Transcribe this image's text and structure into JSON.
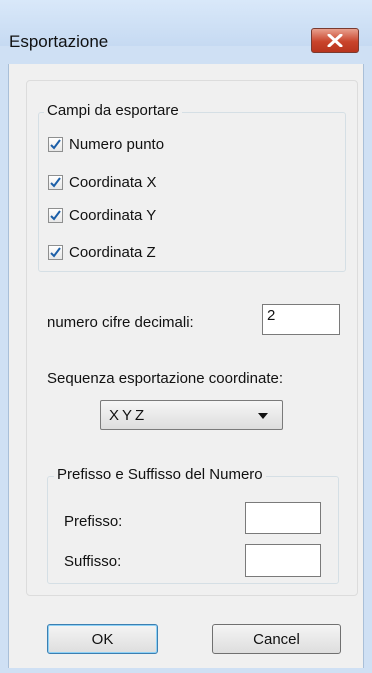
{
  "window": {
    "title": "Esportazione"
  },
  "export_fields": {
    "group_label": "Campi da esportare",
    "items": [
      {
        "label": "Numero punto",
        "checked": true
      },
      {
        "label": "Coordinata X",
        "checked": true
      },
      {
        "label": "Coordinata Y",
        "checked": true
      },
      {
        "label": "Coordinata Z",
        "checked": true
      }
    ]
  },
  "decimals": {
    "label": "numero cifre decimali:",
    "value": "2"
  },
  "sequence": {
    "label": "Sequenza esportazione coordinate:",
    "selected": "XYZ"
  },
  "prefix_suffix": {
    "group_label": "Prefisso e Suffisso del Numero",
    "prefix_label": "Prefisso:",
    "prefix_value": "",
    "suffix_label": "Suffisso:",
    "suffix_value": ""
  },
  "buttons": {
    "ok": "OK",
    "cancel": "Cancel"
  },
  "colors": {
    "accent": "#3c7fb1",
    "close_red": "#c9442b",
    "check_blue": "#1c5fa8"
  }
}
